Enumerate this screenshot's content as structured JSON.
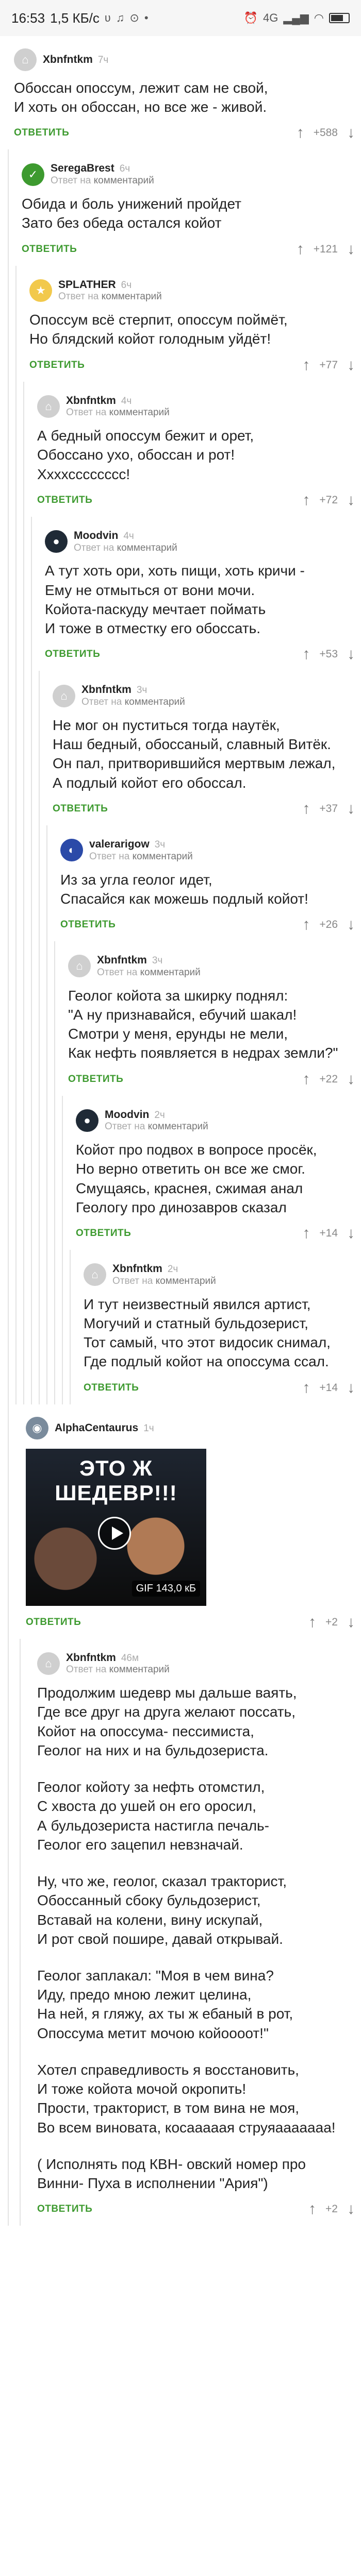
{
  "status_bar": {
    "time": "16:53",
    "speed": "1,5 КБ/с",
    "network": "4G"
  },
  "labels": {
    "reply": "ОТВЕТИТЬ",
    "reply_to": "Ответ на",
    "reply_to_target": "комментарий"
  },
  "comments": [
    {
      "nick": "Xbnfntkm",
      "time": "7ч",
      "reply": false,
      "body": "Обоссан опоссум, лежит сам не свой,\nИ хоть он обоссан, но все же - живой.",
      "rating": "+588"
    },
    {
      "nick": "SeregaBrest",
      "time": "6ч",
      "reply": true,
      "body": "Обида и боль унижений пройдет\nЗато без обеда остался койот",
      "rating": "+121"
    },
    {
      "nick": "SPLATHER",
      "time": "6ч",
      "reply": true,
      "body": "Опоссум всё стерпит, опоссум поймёт,\nНо блядский койот голодным уйдёт!",
      "rating": "+77"
    },
    {
      "nick": "Xbnfntkm",
      "time": "4ч",
      "reply": true,
      "body": "А бедный опоссум бежит и орет,\nОбоссано ухо, обоссан и рот!\nХхххсссссссс!",
      "rating": "+72"
    },
    {
      "nick": "Moodvin",
      "time": "4ч",
      "reply": true,
      "body": "А тут хоть ори, хоть пищи, хоть кричи -\nЕму не отмыться от вони мочи.\nКойота-паскуду мечтает поймать\nИ тоже в отместку его обоссать.",
      "rating": "+53"
    },
    {
      "nick": "Xbnfntkm",
      "time": "3ч",
      "reply": true,
      "body": "Не мог он пуститься тогда наутёк,\nНаш бедный, обоссаный, славный Витёк.\nОн пал, притворившийся мертвым лежал,\nА подлый койот его обоссал.",
      "rating": "+37"
    },
    {
      "nick": "valerarigow",
      "time": "3ч",
      "reply": true,
      "body": "Из за угла геолог идет,\nСпасайся как можешь подлый койот!",
      "rating": "+26"
    },
    {
      "nick": "Xbnfntkm",
      "time": "3ч",
      "reply": true,
      "body": "Геолог койота за шкирку поднял:\n\"А ну признавайся, ебучий шакал!\nСмотри у меня, ерунды не мели,\nКак нефть появляется в недрах земли?\"",
      "rating": "+22"
    },
    {
      "nick": "Moodvin",
      "time": "2ч",
      "reply": true,
      "body": "Койот про подвох в вопросе просёк,\nНо верно ответить он все же смог.\nСмущаясь, краснея, сжимая анал\nГеологу про динозавров сказал",
      "rating": "+14"
    },
    {
      "nick": "Xbnfntkm",
      "time": "2ч",
      "reply": true,
      "body": "И тут неизвестный явился артист,\nМогучий и статный бульдозерист,\nТот самый, что этот видосик снимал,\nГде подлый койот на опоссума ссал.",
      "rating": "+14"
    },
    {
      "nick": "AlphaCentaurus",
      "time": "1ч",
      "reply": false,
      "gif": {
        "title": "ЭТО Ж ШЕДЕВР!!!",
        "badge": "GIF 143,0 кБ"
      },
      "rating": "+2"
    },
    {
      "nick": "Xbnfntkm",
      "time": "46м",
      "reply": true,
      "paragraphs": [
        "Продолжим шедевр мы дальше ваять,\nГде все друг на друга желают поссать,\nКойот на опоссума- пессимиста,\nГеолог на них и на бульдозериста.",
        "Геолог койоту за нефть отомстил,\nС хвоста до ушей он его оросил,\nА бульдозериста настигла печаль-\nГеолог его зацепил невзначай.",
        "Ну, что же, геолог, сказал тракторист,\nОбоссанный сбоку бульдозерист,\nВставай на колени, вину искупай,\nИ рот свой пошире, давай открывай.",
        "Геолог заплакал: \"Моя в чем вина?\nИду, предо мною лежит целина,\nНа ней, я гляжу, ах ты ж ебаный в рот,\nОпоссума метит мочою койоооот!\"",
        "Хотел справедливость я восстановить,\nИ тоже койота мочой окропить!\nПрости, тракторист, в том вина не моя,\nВо всем виновата, косааааая струяааааааа!",
        "( Исполнять под КВН- овский номер про Винни- Пуха в исполнении \"Ария\")"
      ],
      "rating": "+2"
    }
  ],
  "colors": {
    "reply": "#3d9a2f",
    "thread_line": "#e3e3e3"
  }
}
